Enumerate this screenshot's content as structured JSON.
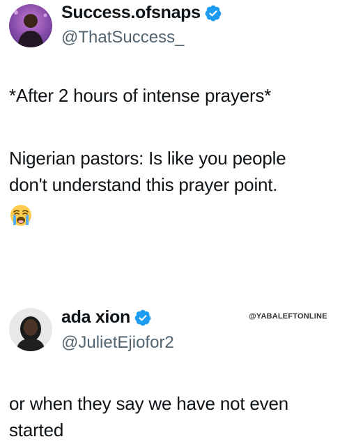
{
  "tweets": [
    {
      "display_name": "Success.ofsnaps",
      "handle": "@ThatSuccess_",
      "verified": true,
      "line1": "*After 2 hours of intense prayers*",
      "line2": "Nigerian pastors: Is like you people",
      "line3": "don't understand this prayer point.",
      "emoji": "loudly-crying-face"
    },
    {
      "display_name": "ada xion",
      "handle": "@JulietEjiofor2",
      "verified": true,
      "line1": "or when they say we have not even",
      "line2": "started"
    }
  ],
  "watermark": "@YABALEFTONLINE",
  "colors": {
    "verified_badge": "#1d9bf0",
    "handle": "#536471",
    "text": "#0f1419"
  }
}
